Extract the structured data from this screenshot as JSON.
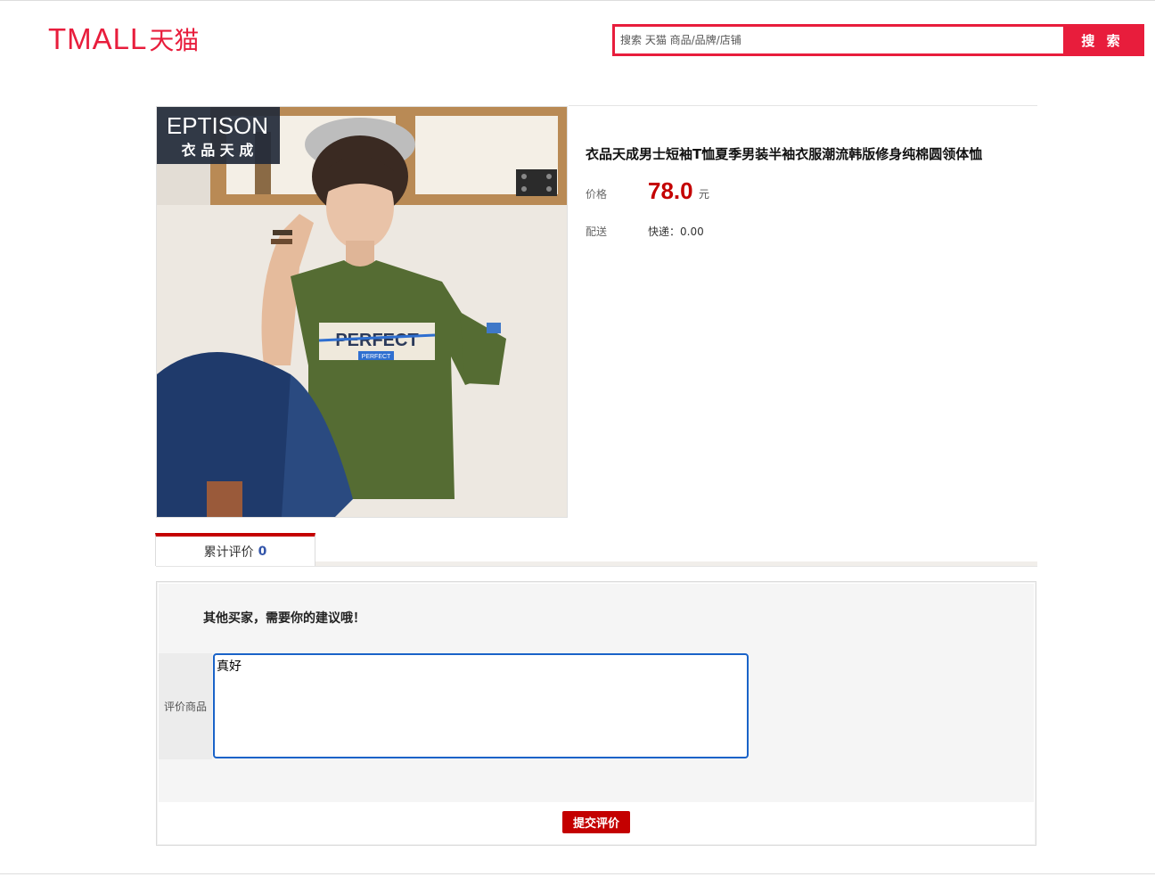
{
  "header": {
    "logo": {
      "latin": "TMALL",
      "cjk": "天猫"
    },
    "search": {
      "placeholder": "搜索 天猫 商品/品牌/店铺",
      "value": "",
      "button_label": "搜 索"
    }
  },
  "product": {
    "image": {
      "brand_latin": "EPTISON",
      "brand_cjk": "衣 品 天 成",
      "shirt_text": "PERFECT",
      "shirt_subtext": "PERFECT"
    },
    "title": "衣品天成男士短袖T恤夏季男装半袖衣服潮流韩版修身纯棉圆领体恤",
    "price_label": "价格",
    "price": "78.0",
    "price_unit": "元",
    "delivery_label": "配送",
    "delivery_value": "快递：0.00"
  },
  "tabs": {
    "review_label": "累计评价",
    "review_count": "0"
  },
  "review_form": {
    "prompt": "其他买家，需要你的建议哦！",
    "field_label": "评价商品",
    "textarea_value": "真好",
    "submit_label": "提交评价"
  },
  "colors": {
    "brand_red": "#e81d3c",
    "price_red": "#c40000",
    "focus_blue": "#1a63c8"
  }
}
